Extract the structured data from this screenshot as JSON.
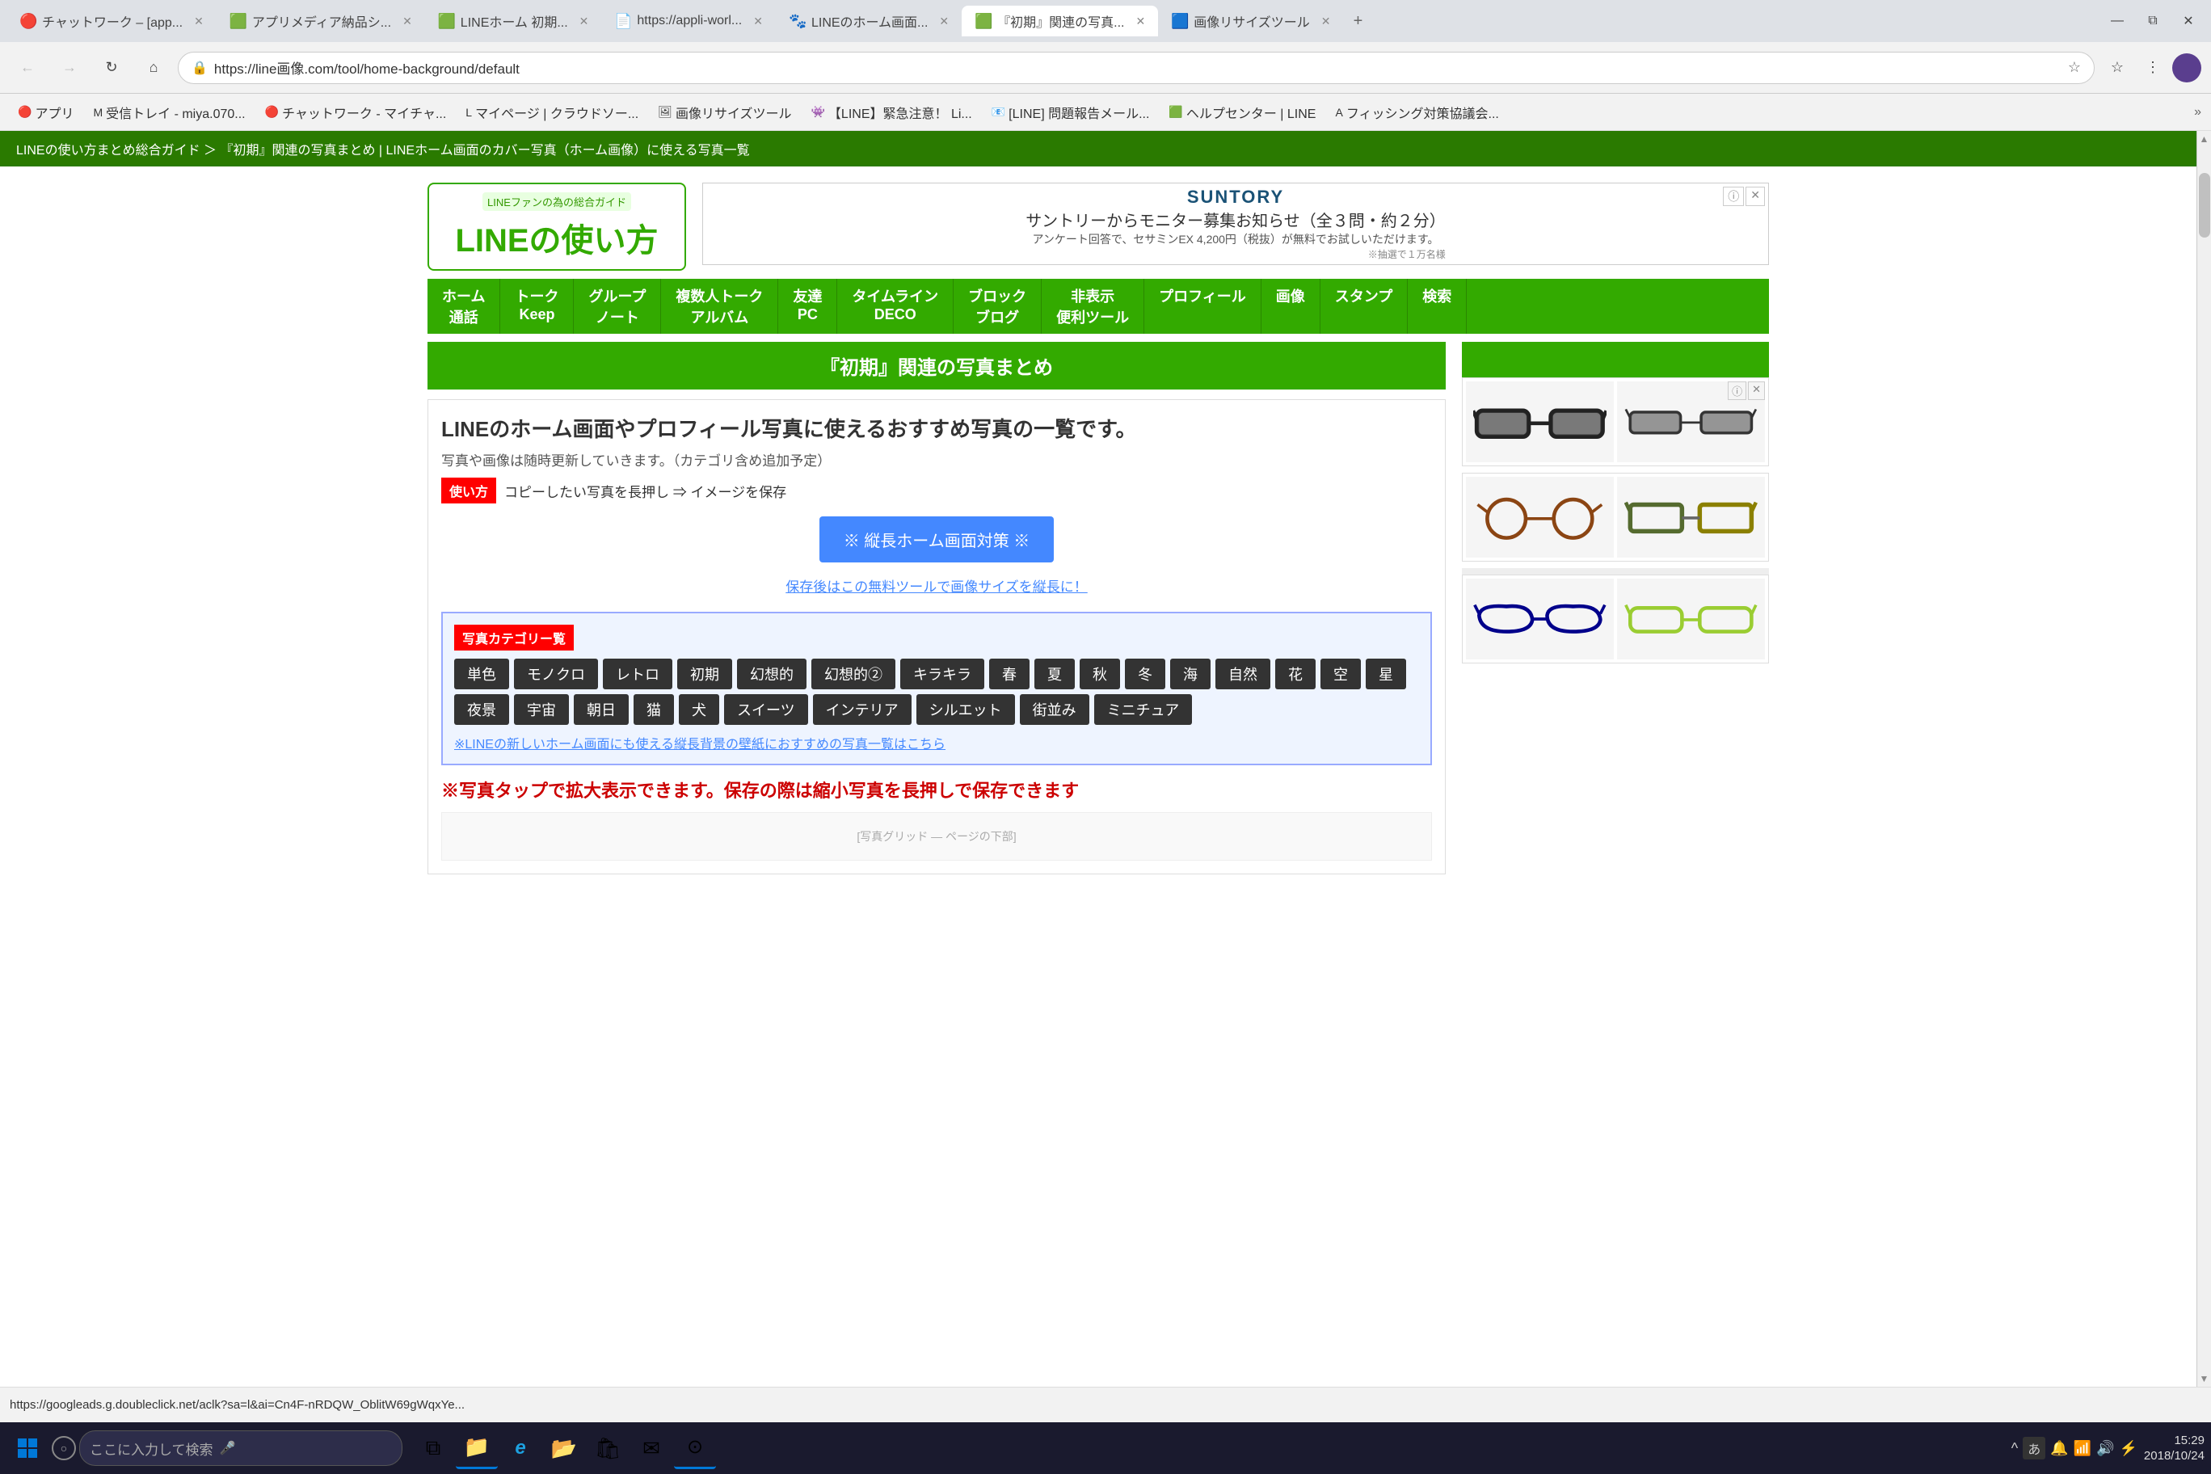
{
  "browser": {
    "tabs": [
      {
        "label": "チャットワーク – [app...",
        "favicon": "🔴",
        "active": false
      },
      {
        "label": "アプリメディア納品シ...",
        "favicon": "🟩",
        "active": false
      },
      {
        "label": "LINEホーム 初期...",
        "favicon": "🟩",
        "active": false
      },
      {
        "label": "https://appli-worl...",
        "favicon": "📄",
        "active": false
      },
      {
        "label": "LINEのホーム画面...",
        "favicon": "🐾",
        "active": false
      },
      {
        "label": "『初期』関連の写真...",
        "favicon": "🟩",
        "active": true
      },
      {
        "label": "画像リサイズツール",
        "favicon": "🟦",
        "active": false
      }
    ],
    "url": "https://line画像.com/tool/home-background/default",
    "nav": {
      "back": false,
      "forward": false,
      "reload": true,
      "home": true
    }
  },
  "bookmarks": [
    {
      "label": "アプリ",
      "favicon": "🔴"
    },
    {
      "label": "M 受信トレイ - miya.070...",
      "favicon": "M"
    },
    {
      "label": "チャットワーク - マイチャ...",
      "favicon": "🔴"
    },
    {
      "label": "L マイページ | クラウドソー...",
      "favicon": "L"
    },
    {
      "label": "画像リサイズツール",
      "favicon": "🖼"
    },
    {
      "label": "【LINE】緊急注意！ Li...",
      "favicon": "👾"
    },
    {
      "label": "[LINE] 問題報告メール...",
      "favicon": "📧"
    },
    {
      "label": "ヘルプセンター | LINE",
      "favicon": "🟩"
    },
    {
      "label": "A フィッシング対策協議会...",
      "favicon": "A"
    }
  ],
  "page": {
    "breadcrumb": "LINEの使い方まとめ総合ガイド ＞ 『初期』関連の写真まとめ | LINEホーム画面のカバー写真（ホーム画像）に使える写真一覧",
    "logo_tagline": "LINEファンの為の総合ガイド",
    "logo_text": "LINEの使い方",
    "ad_brand": "SUNTORY",
    "ad_text": "サントリーからモニター募集お知らせ（全３問・約２分）",
    "ad_sub": "アンケート回答で、セサミンEX 4,200円（税抜）が無料でお試しいただけます。",
    "ad_note": "※抽選で１万名様",
    "nav_items": [
      {
        "main": "ホーム",
        "sub": "通話"
      },
      {
        "main": "トーク",
        "sub": "Keep"
      },
      {
        "main": "グループ",
        "sub": "ノート"
      },
      {
        "main": "複数人トーク",
        "sub": "アルバム"
      },
      {
        "main": "友達",
        "sub": "PC"
      },
      {
        "main": "タイムライン",
        "sub": "DECO"
      },
      {
        "main": "ブロック",
        "sub": "ブログ"
      },
      {
        "main": "非表示",
        "sub": "便利ツール"
      },
      {
        "main": "プロフィール",
        "sub": ""
      },
      {
        "main": "画像",
        "sub": ""
      },
      {
        "main": "スタンプ",
        "sub": ""
      },
      {
        "main": "検索",
        "sub": ""
      }
    ],
    "section_title": "『初期』関連の写真まとめ",
    "main_title": "LINEのホーム画面やプロフィール写真に使えるおすすめ写真の一覧です。",
    "main_desc": "写真や画像は随時更新していきます。（カテゴリ含め追加予定）",
    "usage_label": "使い方",
    "usage_text": "コピーしたい写真を長押し ⇒ イメージを保存",
    "cta_btn": "※ 縦長ホーム画面対策 ※",
    "cta_link": "保存後はこの無料ツールで画像サイズを縦長に！",
    "category_title": "写真カテゴリー覧",
    "categories": [
      "単色",
      "モノクロ",
      "レトロ",
      "初期",
      "幻想的",
      "幻想的②",
      "キラキラ",
      "春",
      "夏",
      "秋",
      "冬",
      "海",
      "自然",
      "花",
      "空",
      "星",
      "夜景",
      "宇宙",
      "朝日",
      "猫",
      "犬",
      "スイーツ",
      "インテリア",
      "シルエット",
      "街並み",
      "ミニチュア"
    ],
    "cat_more_link": "※LINEの新しいホーム画面にも使える縦長背景の壁紙におすすめの写真一覧はこちら",
    "info_note": "※写真タップで拡大表示できます。保存の際は縮小写真を長押しで保存できます"
  },
  "status_bar": {
    "url": "https://googleads.g.doubleclick.net/aclk?sa=l&ai=Cn4F-nRDQW_OblitW69gWqxYe..."
  },
  "taskbar": {
    "search_placeholder": "ここに入力して検索",
    "time": "15:29",
    "date": "2018/10/24",
    "apps": [
      {
        "name": "file-explorer",
        "icon": "📁"
      },
      {
        "name": "edge",
        "icon": "e"
      },
      {
        "name": "explorer",
        "icon": "📂"
      },
      {
        "name": "store",
        "icon": "🏪"
      },
      {
        "name": "mail",
        "icon": "✉"
      },
      {
        "name": "chrome",
        "icon": "⊙"
      }
    ],
    "tray_icons": [
      "^",
      "あ",
      "🔔",
      "📶",
      "🔊",
      "⚡"
    ]
  }
}
